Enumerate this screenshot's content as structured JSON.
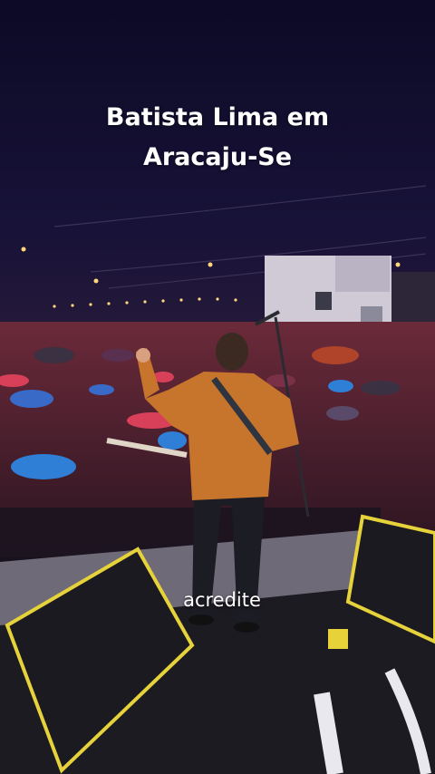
{
  "overlay": {
    "title_line1": "Batista Lima em",
    "title_line2": "Aracaju-Se",
    "caption": "acredite"
  },
  "colors": {
    "sky": "#0d0a24",
    "shirt": "#c7742c",
    "monitor_border": "#e6d23a",
    "umbrella_blue": "#2f7fd6",
    "umbrella_red": "#d8405a"
  }
}
